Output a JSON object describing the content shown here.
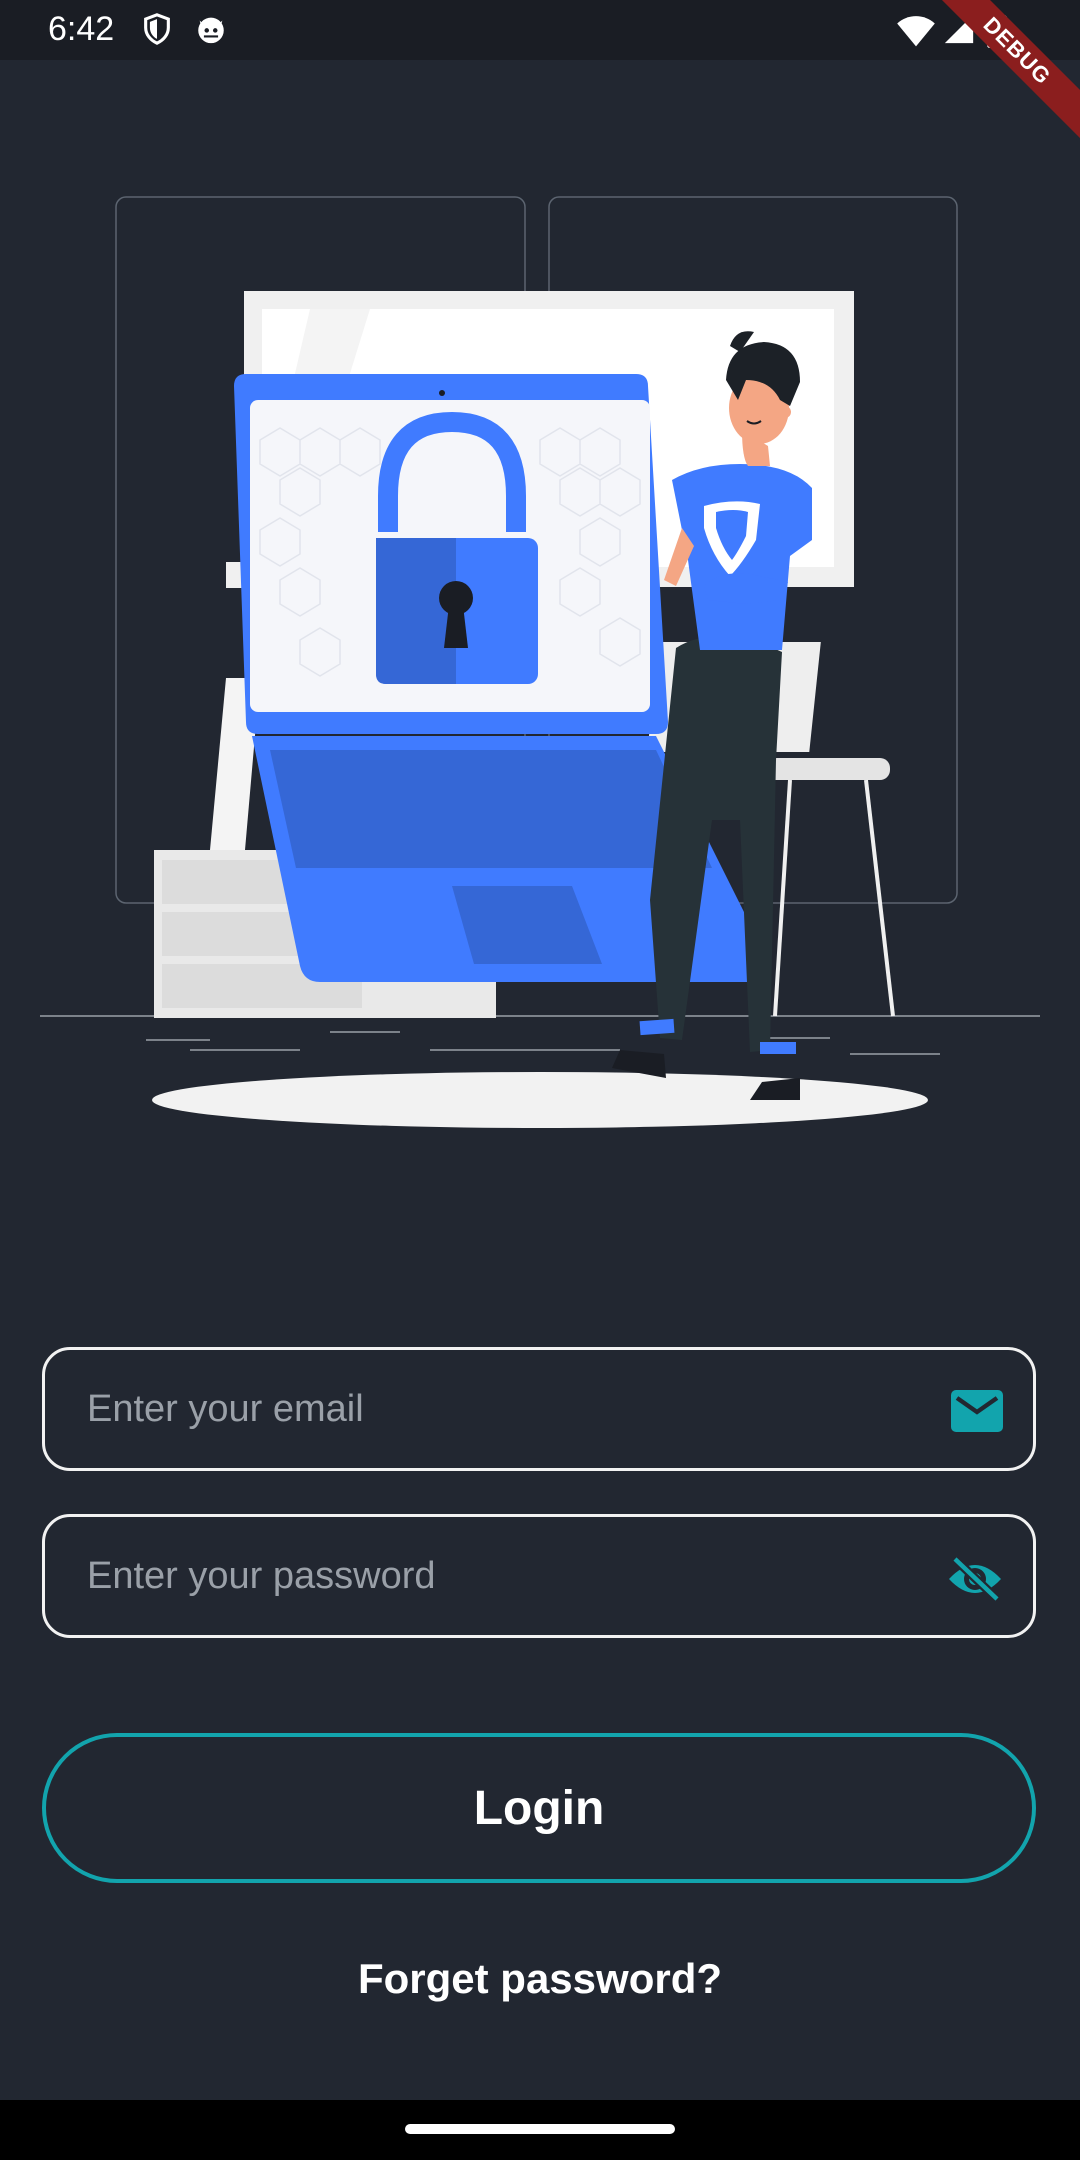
{
  "status_bar": {
    "time": "6:42",
    "icons": [
      "shield-icon",
      "cat-icon",
      "wifi-icon",
      "signal-icon",
      "battery-icon"
    ]
  },
  "debug_banner": "DEBUG",
  "login_form": {
    "email_placeholder": "Enter your email",
    "email_icon": "mail-icon",
    "password_placeholder": "Enter your password",
    "password_icon": "eye-off-icon",
    "login_label": "Login",
    "forgot_label": "Forget password?"
  },
  "colors": {
    "background": "#222731",
    "accent": "#12a4ad",
    "illustration_blue": "#407bff"
  }
}
